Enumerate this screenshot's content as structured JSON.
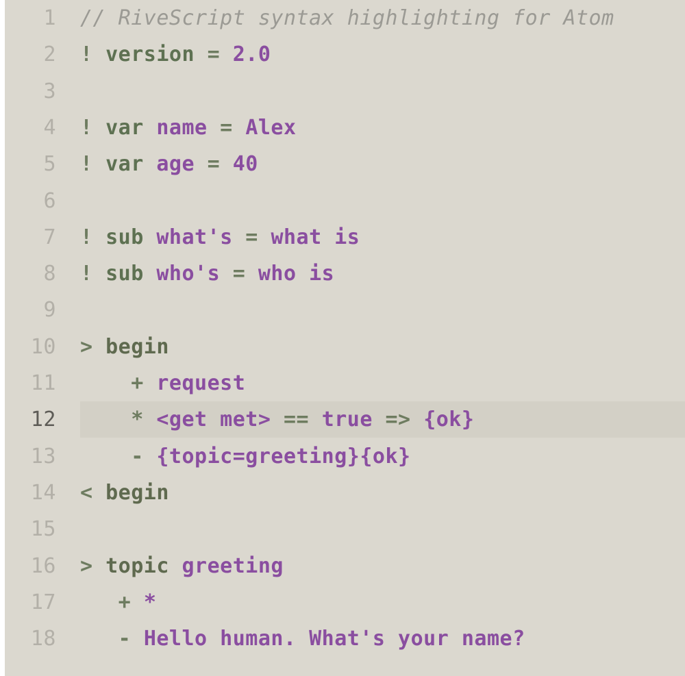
{
  "editor": {
    "colors": {
      "background": "#dbd8cf",
      "active_line": "#d3d0c6",
      "line_number": "#b3b0a8",
      "comment": "#9b9a94",
      "keyword": "#5e7152",
      "value": "#8a4ea0"
    },
    "active_line": 12,
    "lines": [
      {
        "num": "1",
        "tokens": [
          {
            "t": "// RiveScript syntax highlighting for Atom",
            "c": "comment"
          }
        ]
      },
      {
        "num": "2",
        "tokens": [
          {
            "t": "! ",
            "c": "op"
          },
          {
            "t": "version",
            "c": "kw"
          },
          {
            "t": " = ",
            "c": "op"
          },
          {
            "t": "2.0",
            "c": "val"
          }
        ]
      },
      {
        "num": "3",
        "tokens": []
      },
      {
        "num": "4",
        "tokens": [
          {
            "t": "! ",
            "c": "op"
          },
          {
            "t": "var",
            "c": "kw"
          },
          {
            "t": " ",
            "c": "op"
          },
          {
            "t": "name",
            "c": "val"
          },
          {
            "t": " = ",
            "c": "op"
          },
          {
            "t": "Alex",
            "c": "val"
          }
        ]
      },
      {
        "num": "5",
        "tokens": [
          {
            "t": "! ",
            "c": "op"
          },
          {
            "t": "var",
            "c": "kw"
          },
          {
            "t": " ",
            "c": "op"
          },
          {
            "t": "age",
            "c": "val"
          },
          {
            "t": " = ",
            "c": "op"
          },
          {
            "t": "40",
            "c": "val"
          }
        ]
      },
      {
        "num": "6",
        "tokens": []
      },
      {
        "num": "7",
        "tokens": [
          {
            "t": "! ",
            "c": "op"
          },
          {
            "t": "sub",
            "c": "kw"
          },
          {
            "t": " ",
            "c": "op"
          },
          {
            "t": "what's",
            "c": "val"
          },
          {
            "t": " = ",
            "c": "op"
          },
          {
            "t": "what is",
            "c": "val"
          }
        ]
      },
      {
        "num": "8",
        "tokens": [
          {
            "t": "! ",
            "c": "op"
          },
          {
            "t": "sub",
            "c": "kw"
          },
          {
            "t": " ",
            "c": "op"
          },
          {
            "t": "who's",
            "c": "val"
          },
          {
            "t": " = ",
            "c": "op"
          },
          {
            "t": "who is",
            "c": "val"
          }
        ]
      },
      {
        "num": "9",
        "tokens": []
      },
      {
        "num": "10",
        "tokens": [
          {
            "t": "> ",
            "c": "op"
          },
          {
            "t": "begin",
            "c": "cmd"
          }
        ]
      },
      {
        "num": "11",
        "tokens": [
          {
            "t": "    + ",
            "c": "op"
          },
          {
            "t": "request",
            "c": "val"
          }
        ]
      },
      {
        "num": "12",
        "tokens": [
          {
            "t": "    * ",
            "c": "op"
          },
          {
            "t": "<get met>",
            "c": "val"
          },
          {
            "t": " == ",
            "c": "op"
          },
          {
            "t": "true",
            "c": "val"
          },
          {
            "t": " => ",
            "c": "op"
          },
          {
            "t": "{ok}",
            "c": "val"
          }
        ]
      },
      {
        "num": "13",
        "tokens": [
          {
            "t": "    - ",
            "c": "op"
          },
          {
            "t": "{topic=greeting}{ok}",
            "c": "val"
          }
        ]
      },
      {
        "num": "14",
        "tokens": [
          {
            "t": "< ",
            "c": "op"
          },
          {
            "t": "begin",
            "c": "cmd"
          }
        ]
      },
      {
        "num": "15",
        "tokens": []
      },
      {
        "num": "16",
        "tokens": [
          {
            "t": "> ",
            "c": "op"
          },
          {
            "t": "topic",
            "c": "cmd"
          },
          {
            "t": " ",
            "c": "op"
          },
          {
            "t": "greeting",
            "c": "val"
          }
        ]
      },
      {
        "num": "17",
        "tokens": [
          {
            "t": "   + ",
            "c": "op"
          },
          {
            "t": "*",
            "c": "val"
          }
        ]
      },
      {
        "num": "18",
        "tokens": [
          {
            "t": "   - ",
            "c": "op"
          },
          {
            "t": "Hello human. What's your name?",
            "c": "val"
          }
        ]
      }
    ]
  }
}
